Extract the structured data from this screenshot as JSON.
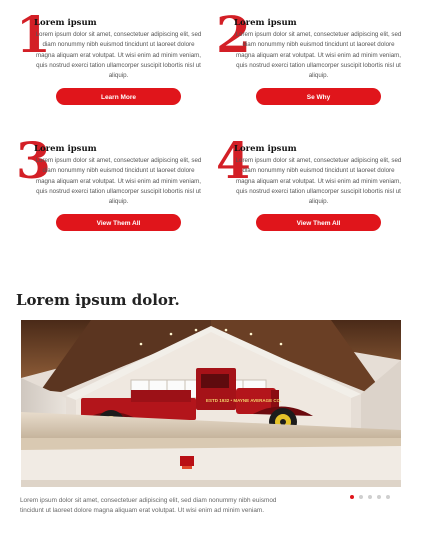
{
  "cards": [
    {
      "number": "1",
      "title": "Lorem ipsum",
      "body": "Lorem ipsum dolor sit amet, consectetuer adipiscing elit, sed diam nonummy nibh euismod tincidunt ut laoreet dolore magna aliquam erat volutpat. Ut wisi enim ad minim veniam, quis nostrud exerci tation ullamcorper suscipit lobortis nisl ut aliquip.",
      "button": "Learn More"
    },
    {
      "number": "2",
      "title": "Lorem ipsum",
      "body": "Lorem ipsum dolor sit amet, consectetuer adipiscing elit, sed diam nonummy nibh euismod tincidunt ut laoreet dolore magna aliquam erat volutpat. Ut wisi enim ad minim veniam, quis nostrud exerci tation ullamcorper suscipit lobortis nisl ut aliquip.",
      "button": "Se Why"
    },
    {
      "number": "3",
      "title": "Lorem ipsum",
      "body": "Lorem ipsum dolor sit amet, consectetuer adipiscing elit, sed diam nonummy nibh euismod tincidunt ut laoreet dolore magna aliquam erat volutpat. Ut wisi enim ad minim veniam, quis nostrud exerci tation ullamcorper suscipit lobortis nisl ut aliquip.",
      "button": "View Them All"
    },
    {
      "number": "4",
      "title": "Lorem ipsum",
      "body": "Lorem ipsum dolor sit amet, consectetuer adipiscing elit, sed diam nonummy nibh euismod tincidunt ut laoreet dolore magna aliquam erat volutpat. Ut wisi enim ad minim veniam, quis nostrud exerci tation ullamcorper suscipit lobortis nisl ut aliquip.",
      "button": "View Them All"
    }
  ],
  "section": {
    "title": "Lorem ipsum dolor."
  },
  "slider": {
    "caption": "Lorem ipsum dolor sit amet, consectetuer adipiscing elit, sed diam nonummy nibh euismod tincidunt ut laoreet dolore magna aliquam erat volutpat. Ut wisi enim ad minim veniam.",
    "truck_sign": "ESTD 1932 • MAYNE AVERAGE CO.",
    "slide_count": 5,
    "active_slide": 1
  },
  "colors": {
    "accent": "#e0151b",
    "number": "#d31f26"
  }
}
